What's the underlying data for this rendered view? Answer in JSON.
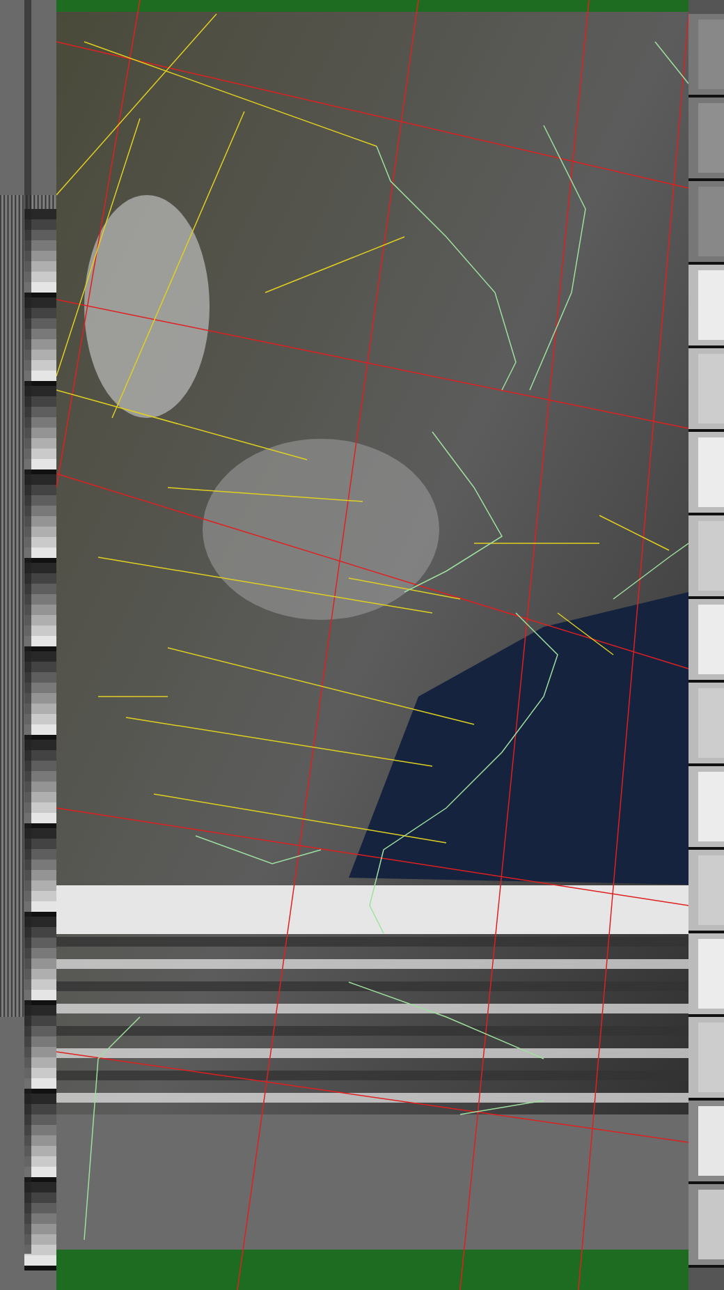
{
  "image": {
    "strips": [
      {
        "kind": "wedges"
      },
      {
        "kind": "map"
      },
      {
        "kind": "blocks"
      }
    ]
  }
}
